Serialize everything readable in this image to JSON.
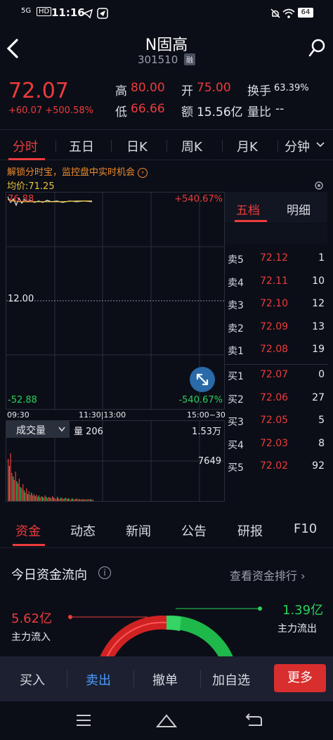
{
  "status": {
    "time": "11:16",
    "net": "5G",
    "hd": "HD",
    "battery": "64"
  },
  "header": {
    "title": "N固高",
    "code": "301510",
    "badge": "融"
  },
  "quote": {
    "price": "72.07",
    "change": "+60.07 +500.58%",
    "high_label": "高",
    "high": "80.00",
    "open_label": "开",
    "open": "75.00",
    "turnover_label": "换手",
    "turnover": "63.39%",
    "low_label": "低",
    "low": "66.66",
    "amount_label": "额",
    "amount": "15.56亿",
    "vol_ratio_label": "量比",
    "vol_ratio": "--"
  },
  "tabs": [
    "分时",
    "五日",
    "日K",
    "周K",
    "月K",
    "分钟"
  ],
  "promo": "解锁分时宝，监控盘中实时机会",
  "avg_price": "均价:71.25",
  "chart": {
    "top_left": "76.88",
    "top_right": "+540.67%",
    "mid": "12.00",
    "bottom_left": "-52.88",
    "bottom_right": "-540.67%",
    "time_labels": [
      "09:30",
      "11:30|13:00",
      "15:00~30"
    ]
  },
  "volume": {
    "selector": "成交量",
    "label": "量 206",
    "max": "1.53万",
    "mid": "7649"
  },
  "orderbook": {
    "tabs": [
      "五档",
      "明细"
    ],
    "asks": [
      {
        "label": "卖5",
        "price": "72.12",
        "vol": "1"
      },
      {
        "label": "卖4",
        "price": "72.11",
        "vol": "10"
      },
      {
        "label": "卖3",
        "price": "72.10",
        "vol": "12"
      },
      {
        "label": "卖2",
        "price": "72.09",
        "vol": "13"
      },
      {
        "label": "卖1",
        "price": "72.08",
        "vol": "19"
      }
    ],
    "bids": [
      {
        "label": "买1",
        "price": "72.07",
        "vol": "0"
      },
      {
        "label": "买2",
        "price": "72.06",
        "vol": "27"
      },
      {
        "label": "买3",
        "price": "72.05",
        "vol": "5"
      },
      {
        "label": "买4",
        "price": "72.03",
        "vol": "8"
      },
      {
        "label": "买5",
        "price": "72.02",
        "vol": "92"
      }
    ]
  },
  "bottom_tabs": [
    "资金",
    "动态",
    "新闻",
    "公告",
    "研报",
    "F10"
  ],
  "fund_flow": {
    "title": "今日资金流向",
    "rank_link": "查看资金排行",
    "inflow_value": "5.62亿",
    "inflow_label": "主力流入",
    "outflow_value": "1.39亿",
    "outflow_label": "主力流出"
  },
  "actions": {
    "buy": "买入",
    "sell": "卖出",
    "cancel": "撤单",
    "watch": "加自选",
    "more": "更多"
  },
  "colors": {
    "up": "#ee3b3b",
    "down": "#2bd15a",
    "bg": "#0b0e17",
    "avg": "#e8c33a"
  }
}
